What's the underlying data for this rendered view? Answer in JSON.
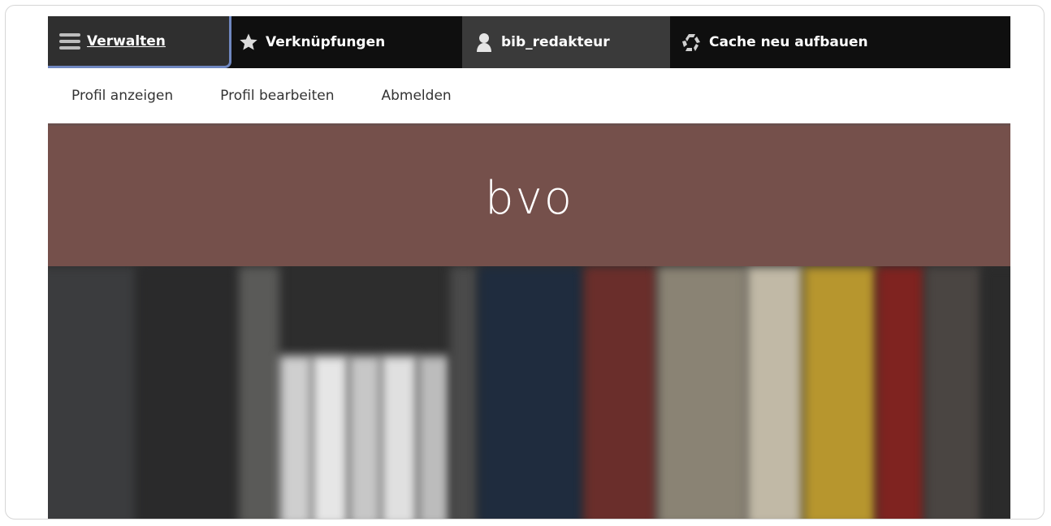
{
  "toolbar": {
    "manage_label": "Verwalten",
    "shortcuts_label": "Verknüpfungen",
    "user_label": "bib_redakteur",
    "cache_label": "Cache neu aufbauen",
    "icons": [
      "menu-icon",
      "star-icon",
      "user-icon",
      "recycle-icon"
    ]
  },
  "tray": {
    "items": [
      "Profil anzeigen",
      "Profil bearbeiten",
      "Abmelden"
    ]
  },
  "brand": {
    "logo_text": "bvo",
    "color": "#75504b"
  },
  "colors": {
    "toolbar_bg": "#0f0f0f",
    "active_tab_border": "#6f87c0"
  }
}
